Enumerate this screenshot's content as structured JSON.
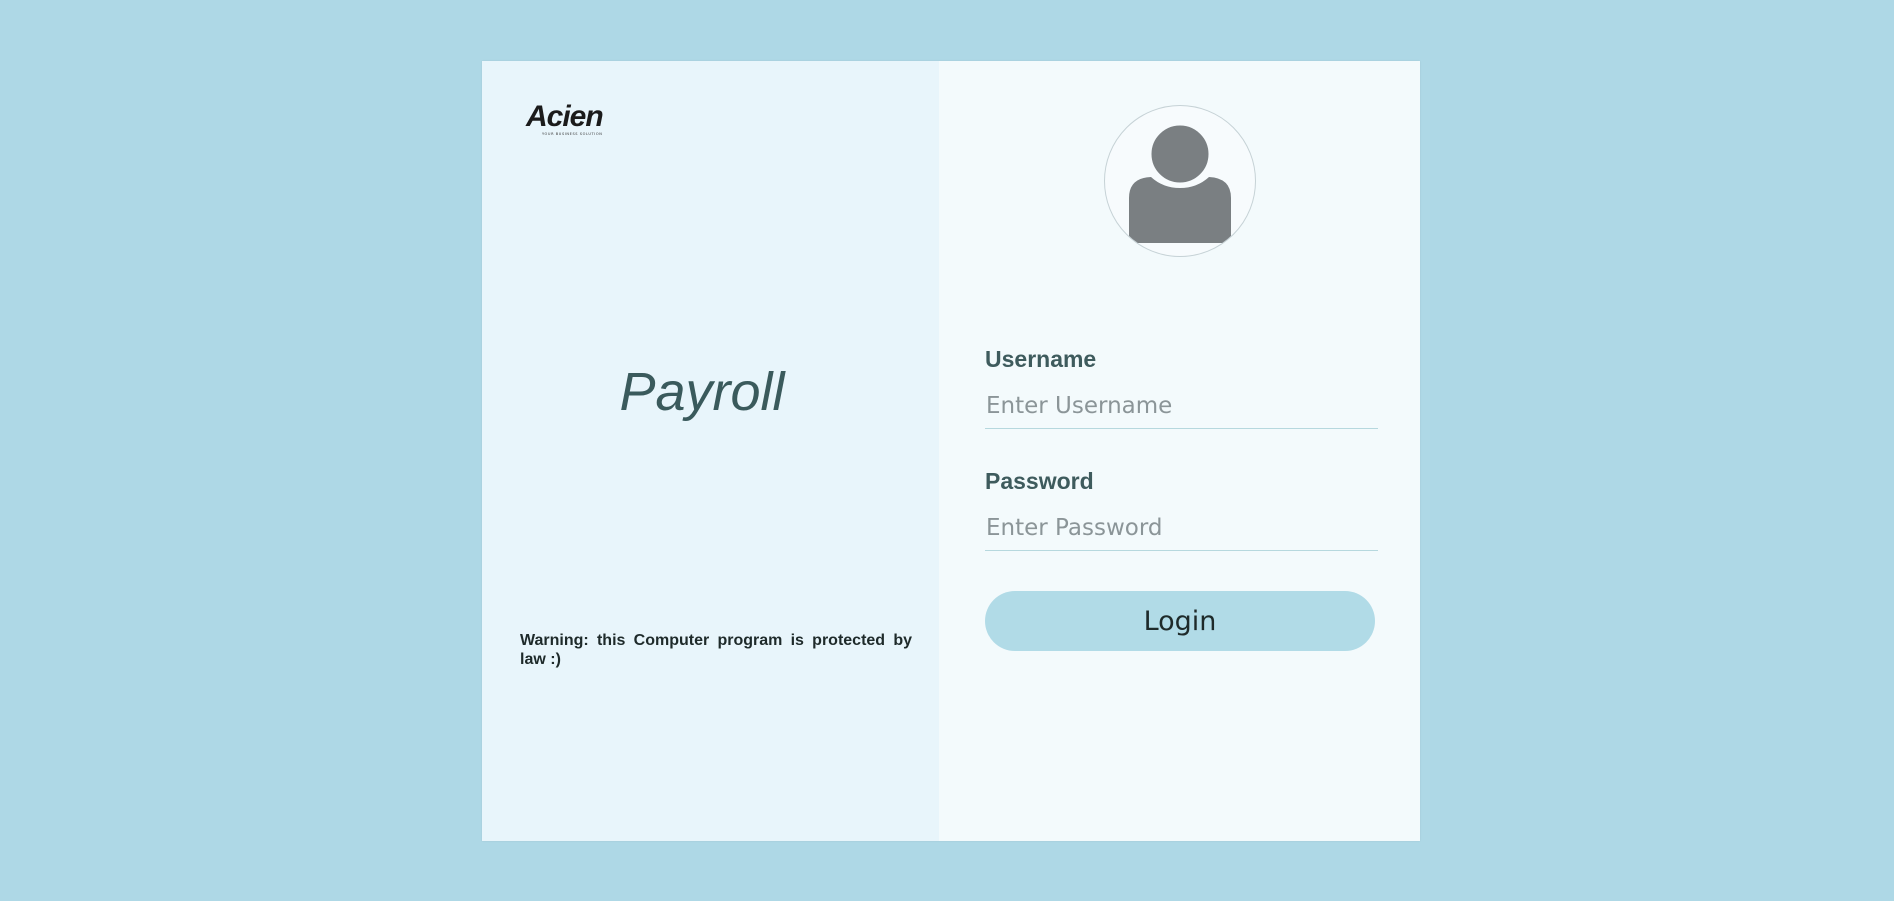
{
  "brand": {
    "logo_text": "Acien",
    "logo_tagline": "YOUR BUSINESS SOLUTION"
  },
  "left_panel": {
    "title": "Payroll",
    "warning": "Warning: this Computer program is protected by law :)"
  },
  "login_form": {
    "username_label": "Username",
    "username_placeholder": "Enter Username",
    "password_label": "Password",
    "password_placeholder": "Enter Password",
    "login_label": "Login"
  },
  "colors": {
    "page_background": "#aed8e6",
    "left_panel": "#e8f5fb",
    "right_panel": "#f3fafc",
    "label_text": "#3e5b5d",
    "button": "#b1dbe7",
    "avatar_icon": "#7a7f82"
  },
  "icons": {
    "avatar": "user-avatar-icon"
  }
}
